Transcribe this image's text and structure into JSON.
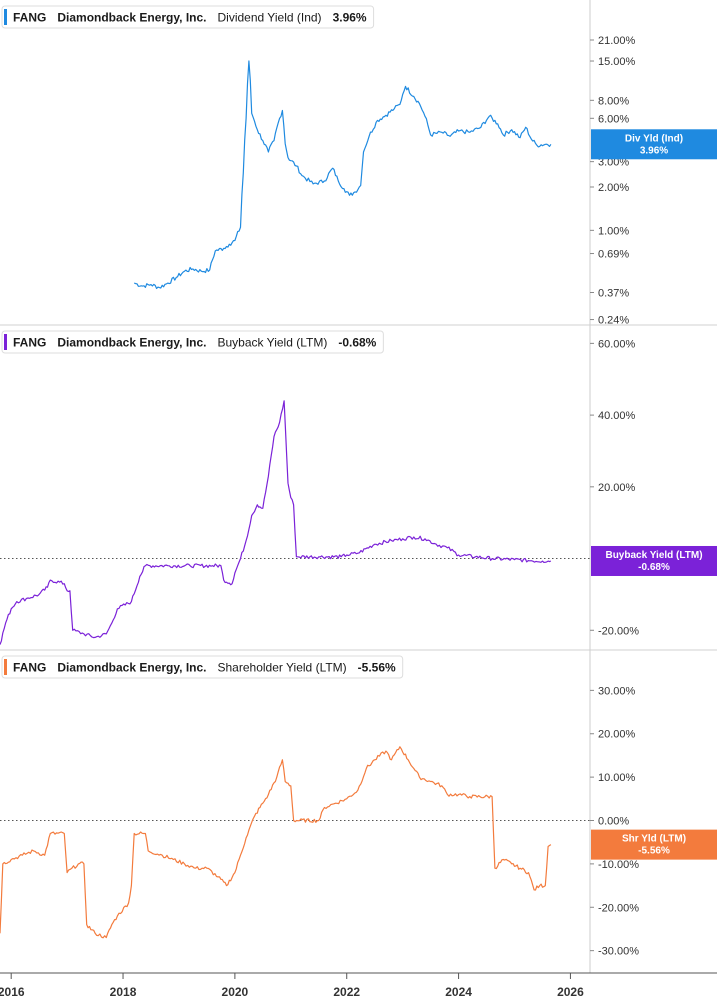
{
  "chart_data": [
    {
      "type": "line",
      "ticker": "FANG",
      "company": "Diamondback Energy, Inc.",
      "metric": "Dividend Yield (Ind)",
      "last_value": "3.96%",
      "tag_label": "Div Yld (Ind)",
      "tag_value": "3.96%",
      "color": "#1f8ae0",
      "scale": "log",
      "ylim": [
        0.22,
        28
      ],
      "yticks": [
        {
          "v": 21,
          "label": "21.00%"
        },
        {
          "v": 15,
          "label": "15.00%"
        },
        {
          "v": 8,
          "label": "8.00%"
        },
        {
          "v": 6,
          "label": "6.00%"
        },
        {
          "v": 3,
          "label": "3.00%"
        },
        {
          "v": 2,
          "label": "2.00%"
        },
        {
          "v": 1,
          "label": "1.00%"
        },
        {
          "v": 0.69,
          "label": "0.69%"
        },
        {
          "v": 0.37,
          "label": "0.37%"
        },
        {
          "v": 0.24,
          "label": "0.24%"
        }
      ],
      "zero_line": false,
      "points": [
        [
          2018.2,
          0.43
        ],
        [
          2018.35,
          0.41
        ],
        [
          2018.5,
          0.42
        ],
        [
          2018.65,
          0.4
        ],
        [
          2018.8,
          0.43
        ],
        [
          2018.95,
          0.47
        ],
        [
          2019.1,
          0.52
        ],
        [
          2019.25,
          0.54
        ],
        [
          2019.4,
          0.52
        ],
        [
          2019.55,
          0.53
        ],
        [
          2019.65,
          0.72
        ],
        [
          2019.8,
          0.75
        ],
        [
          2019.9,
          0.8
        ],
        [
          2020.0,
          0.85
        ],
        [
          2020.1,
          1.05
        ],
        [
          2020.15,
          2.5
        ],
        [
          2020.2,
          6.0
        ],
        [
          2020.25,
          15.0
        ],
        [
          2020.3,
          6.5
        ],
        [
          2020.4,
          5.0
        ],
        [
          2020.5,
          4.2
        ],
        [
          2020.6,
          3.5
        ],
        [
          2020.7,
          4.2
        ],
        [
          2020.8,
          6.0
        ],
        [
          2020.85,
          6.8
        ],
        [
          2020.9,
          4.0
        ],
        [
          2020.95,
          3.2
        ],
        [
          2021.1,
          2.8
        ],
        [
          2021.2,
          2.4
        ],
        [
          2021.4,
          2.1
        ],
        [
          2021.6,
          2.2
        ],
        [
          2021.75,
          2.7
        ],
        [
          2021.85,
          2.2
        ],
        [
          2021.95,
          1.95
        ],
        [
          2022.05,
          1.75
        ],
        [
          2022.15,
          1.85
        ],
        [
          2022.25,
          2.05
        ],
        [
          2022.3,
          3.5
        ],
        [
          2022.4,
          4.5
        ],
        [
          2022.55,
          5.8
        ],
        [
          2022.7,
          6.3
        ],
        [
          2022.85,
          7.0
        ],
        [
          2022.95,
          7.5
        ],
        [
          2023.0,
          8.8
        ],
        [
          2023.05,
          10.0
        ],
        [
          2023.2,
          8.5
        ],
        [
          2023.3,
          7.6
        ],
        [
          2023.4,
          6.2
        ],
        [
          2023.5,
          4.6
        ],
        [
          2023.7,
          4.8
        ],
        [
          2023.85,
          4.5
        ],
        [
          2024.0,
          4.9
        ],
        [
          2024.2,
          4.8
        ],
        [
          2024.4,
          5.2
        ],
        [
          2024.55,
          6.2
        ],
        [
          2024.7,
          5.5
        ],
        [
          2024.8,
          4.6
        ],
        [
          2024.95,
          5.0
        ],
        [
          2025.1,
          4.4
        ],
        [
          2025.2,
          5.2
        ],
        [
          2025.3,
          4.3
        ],
        [
          2025.4,
          3.9
        ],
        [
          2025.55,
          3.96
        ],
        [
          2025.65,
          3.96
        ]
      ]
    },
    {
      "type": "line",
      "ticker": "FANG",
      "company": "Diamondback Energy, Inc.",
      "metric": "Buyback Yield (LTM)",
      "last_value": "-0.68%",
      "tag_label": "Buyback Yield (LTM)",
      "tag_value": "-0.68%",
      "color": "#7b22d8",
      "scale": "linear",
      "ylim": [
        -25.5,
        61.5
      ],
      "yticks": [
        {
          "v": 60,
          "label": "60.00%"
        },
        {
          "v": 40,
          "label": "40.00%"
        },
        {
          "v": 20,
          "label": "20.00%"
        },
        {
          "v": -20,
          "label": "-20.00%"
        }
      ],
      "zero_line": true,
      "points": [
        [
          2015.8,
          -24
        ],
        [
          2015.9,
          -18
        ],
        [
          2016.0,
          -14
        ],
        [
          2016.1,
          -12
        ],
        [
          2016.3,
          -11
        ],
        [
          2016.5,
          -10
        ],
        [
          2016.65,
          -8
        ],
        [
          2016.7,
          -6
        ],
        [
          2016.95,
          -7
        ],
        [
          2017.0,
          -9
        ],
        [
          2017.05,
          -9
        ],
        [
          2017.1,
          -20
        ],
        [
          2017.3,
          -21
        ],
        [
          2017.5,
          -22
        ],
        [
          2017.7,
          -21
        ],
        [
          2017.8,
          -18
        ],
        [
          2017.9,
          -14
        ],
        [
          2018.15,
          -12
        ],
        [
          2018.3,
          -5
        ],
        [
          2018.4,
          -2
        ],
        [
          2018.8,
          -2
        ],
        [
          2019.2,
          -2
        ],
        [
          2019.6,
          -2
        ],
        [
          2019.75,
          -2
        ],
        [
          2019.8,
          -6
        ],
        [
          2019.95,
          -7
        ],
        [
          2020.0,
          -4
        ],
        [
          2020.1,
          0
        ],
        [
          2020.2,
          5
        ],
        [
          2020.3,
          12
        ],
        [
          2020.4,
          15
        ],
        [
          2020.5,
          14
        ],
        [
          2020.6,
          23
        ],
        [
          2020.7,
          34
        ],
        [
          2020.8,
          38
        ],
        [
          2020.88,
          44
        ],
        [
          2020.95,
          21
        ],
        [
          2021.0,
          17
        ],
        [
          2021.05,
          15
        ],
        [
          2021.1,
          0.5
        ],
        [
          2021.5,
          0.5
        ],
        [
          2021.9,
          0.5
        ],
        [
          2022.0,
          1
        ],
        [
          2022.2,
          1.5
        ],
        [
          2022.5,
          4
        ],
        [
          2022.8,
          5
        ],
        [
          2023.0,
          5.5
        ],
        [
          2023.2,
          6
        ],
        [
          2023.4,
          5.5
        ],
        [
          2023.6,
          4
        ],
        [
          2023.8,
          3
        ],
        [
          2024.0,
          1
        ],
        [
          2024.3,
          0.5
        ],
        [
          2024.6,
          0
        ],
        [
          2025.0,
          -0.3
        ],
        [
          2025.3,
          -0.6
        ],
        [
          2025.5,
          -0.7
        ],
        [
          2025.65,
          -0.68
        ]
      ]
    },
    {
      "type": "line",
      "ticker": "FANG",
      "company": "Diamondback Energy, Inc.",
      "metric": "Shareholder Yield (LTM)",
      "last_value": "-5.56%",
      "tag_label": "Shr Yld (LTM)",
      "tag_value": "-5.56%",
      "color": "#f37b3d",
      "scale": "linear",
      "ylim": [
        -34,
        37
      ],
      "yticks": [
        {
          "v": 30,
          "label": "30.00%"
        },
        {
          "v": 20,
          "label": "20.00%"
        },
        {
          "v": 10,
          "label": "10.00%"
        },
        {
          "v": 0,
          "label": "0.00%"
        },
        {
          "v": -10,
          "label": "-10.00%"
        },
        {
          "v": -20,
          "label": "-20.00%"
        },
        {
          "v": -30,
          "label": "-30.00%"
        }
      ],
      "zero_line": true,
      "points": [
        [
          2015.8,
          -26
        ],
        [
          2015.85,
          -10
        ],
        [
          2016.0,
          -9
        ],
        [
          2016.2,
          -8
        ],
        [
          2016.4,
          -7
        ],
        [
          2016.6,
          -8
        ],
        [
          2016.7,
          -3
        ],
        [
          2016.95,
          -3
        ],
        [
          2017.0,
          -12
        ],
        [
          2017.2,
          -10
        ],
        [
          2017.3,
          -10
        ],
        [
          2017.35,
          -24
        ],
        [
          2017.5,
          -26
        ],
        [
          2017.7,
          -27
        ],
        [
          2017.8,
          -24
        ],
        [
          2017.9,
          -22
        ],
        [
          2018.1,
          -19
        ],
        [
          2018.15,
          -15
        ],
        [
          2018.2,
          -3
        ],
        [
          2018.4,
          -3
        ],
        [
          2018.45,
          -7
        ],
        [
          2018.7,
          -8
        ],
        [
          2018.9,
          -9
        ],
        [
          2019.1,
          -10
        ],
        [
          2019.3,
          -11
        ],
        [
          2019.5,
          -11
        ],
        [
          2019.7,
          -13
        ],
        [
          2019.85,
          -15
        ],
        [
          2020.0,
          -12
        ],
        [
          2020.1,
          -8
        ],
        [
          2020.2,
          -4
        ],
        [
          2020.35,
          1
        ],
        [
          2020.5,
          4
        ],
        [
          2020.6,
          6
        ],
        [
          2020.75,
          10
        ],
        [
          2020.85,
          14
        ],
        [
          2020.9,
          9
        ],
        [
          2021.0,
          8
        ],
        [
          2021.05,
          0
        ],
        [
          2021.5,
          0
        ],
        [
          2021.6,
          3
        ],
        [
          2021.8,
          4
        ],
        [
          2022.0,
          5
        ],
        [
          2022.2,
          7
        ],
        [
          2022.35,
          12
        ],
        [
          2022.5,
          14
        ],
        [
          2022.7,
          16
        ],
        [
          2022.8,
          14
        ],
        [
          2022.95,
          17
        ],
        [
          2023.1,
          14
        ],
        [
          2023.2,
          12
        ],
        [
          2023.3,
          10
        ],
        [
          2023.5,
          9
        ],
        [
          2023.7,
          8
        ],
        [
          2023.8,
          6
        ],
        [
          2024.0,
          6
        ],
        [
          2024.2,
          5.5
        ],
        [
          2024.6,
          5.5
        ],
        [
          2024.65,
          -11
        ],
        [
          2024.8,
          -9
        ],
        [
          2024.95,
          -10
        ],
        [
          2025.1,
          -11
        ],
        [
          2025.25,
          -12
        ],
        [
          2025.35,
          -16
        ],
        [
          2025.45,
          -15
        ],
        [
          2025.55,
          -15
        ],
        [
          2025.6,
          -6
        ],
        [
          2025.65,
          -5.56
        ]
      ]
    }
  ],
  "x_axis": {
    "range": [
      2015.8,
      2026.35
    ],
    "ticks": [
      {
        "v": 2016,
        "label": "2016"
      },
      {
        "v": 2018,
        "label": "2018"
      },
      {
        "v": 2020,
        "label": "2020"
      },
      {
        "v": 2022,
        "label": "2022"
      },
      {
        "v": 2024,
        "label": "2024"
      },
      {
        "v": 2026,
        "label": "2026"
      }
    ]
  }
}
